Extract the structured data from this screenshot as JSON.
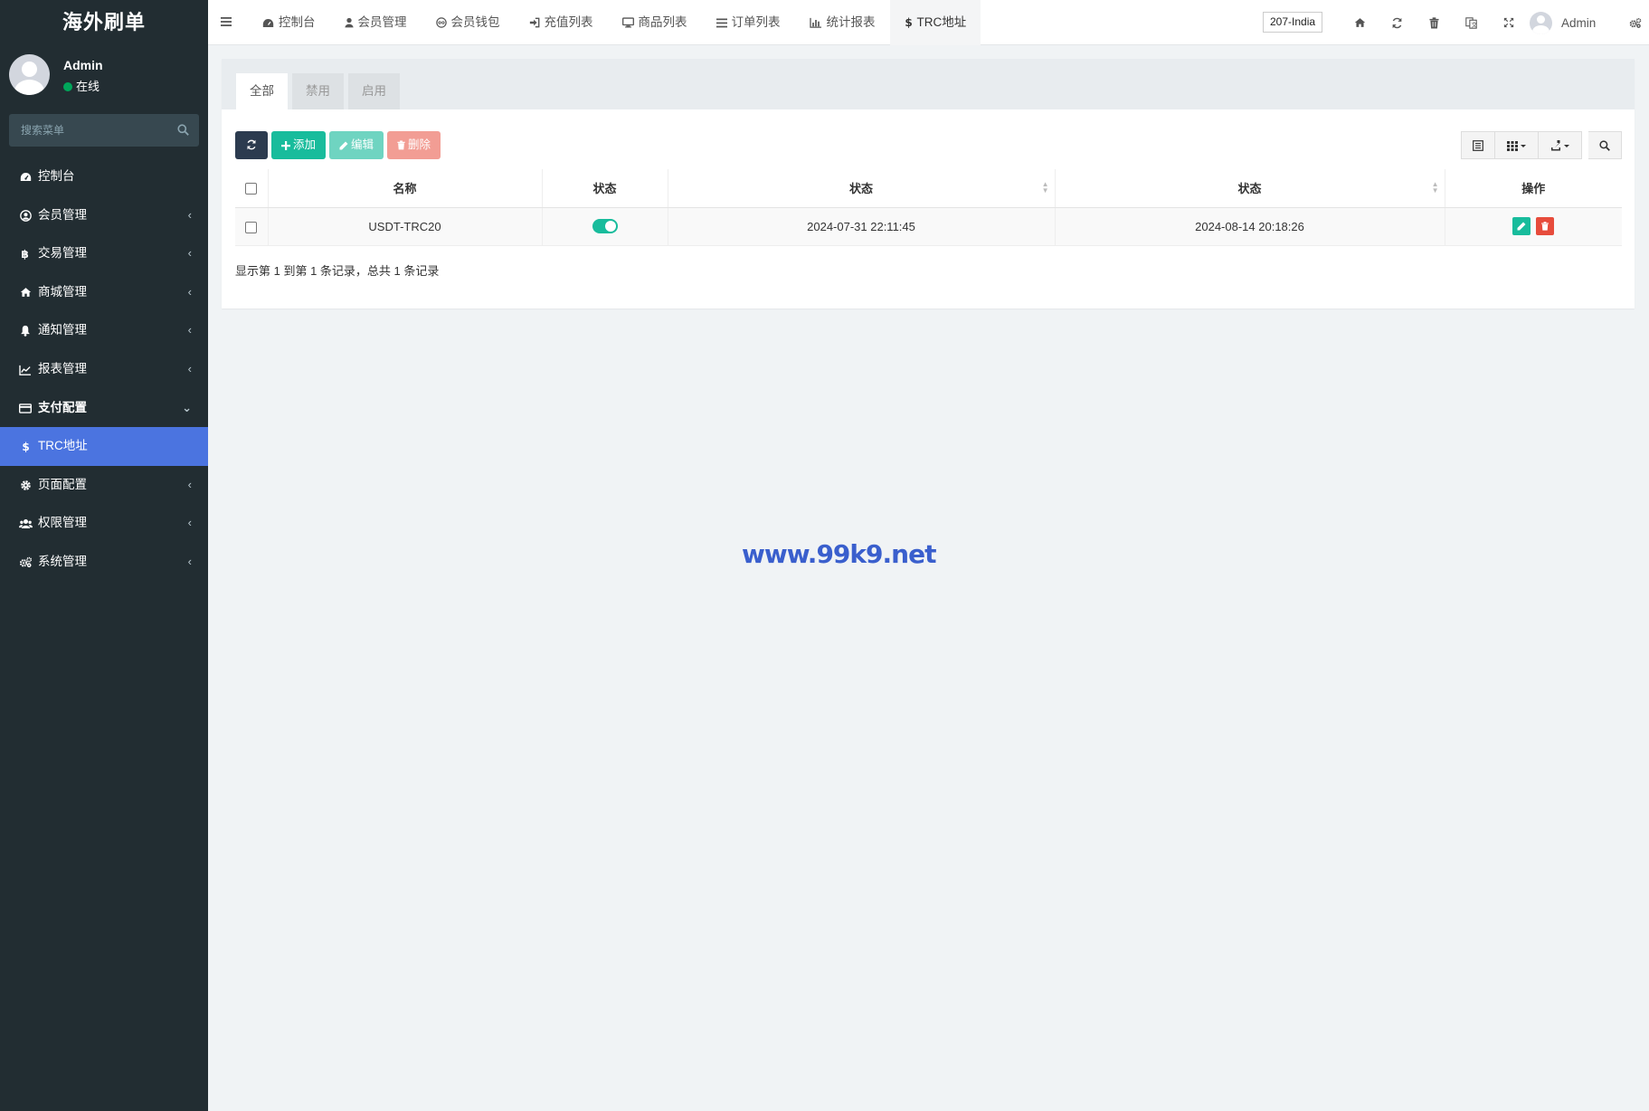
{
  "brand": {
    "title": "海外刷单"
  },
  "user": {
    "name": "Admin",
    "status": "在线"
  },
  "sidebar": {
    "search_placeholder": "搜索菜单",
    "items": [
      {
        "label": "控制台",
        "icon": "dashboard-icon"
      },
      {
        "label": "会员管理",
        "icon": "user-circle-icon"
      },
      {
        "label": "交易管理",
        "icon": "bitcoin-icon"
      },
      {
        "label": "商城管理",
        "icon": "home-icon"
      },
      {
        "label": "通知管理",
        "icon": "bell-icon"
      },
      {
        "label": "报表管理",
        "icon": "line-chart-icon"
      },
      {
        "label": "支付配置",
        "icon": "credit-card-icon"
      },
      {
        "label": "TRC地址",
        "icon": "dollar-icon"
      },
      {
        "label": "页面配置",
        "icon": "gear-icon"
      },
      {
        "label": "权限管理",
        "icon": "users-icon"
      },
      {
        "label": "系统管理",
        "icon": "gears-icon"
      }
    ]
  },
  "topnav": {
    "tabs": [
      {
        "label": "控制台",
        "icon": "dashboard-icon"
      },
      {
        "label": "会员管理",
        "icon": "user-icon"
      },
      {
        "label": "会员钱包",
        "icon": "wallet-icon"
      },
      {
        "label": "充值列表",
        "icon": "sign-in-icon"
      },
      {
        "label": "商品列表",
        "icon": "desktop-icon"
      },
      {
        "label": "订单列表",
        "icon": "list-icon"
      },
      {
        "label": "统计报表",
        "icon": "bar-chart-icon"
      },
      {
        "label": "TRC地址",
        "icon": "dollar-icon"
      }
    ],
    "server": "207-India",
    "user_name": "Admin"
  },
  "panel": {
    "tabs": [
      "全部",
      "禁用",
      "启用"
    ],
    "buttons": {
      "add": "添加",
      "edit": "编辑",
      "delete": "删除"
    },
    "table": {
      "headers": [
        "名称",
        "状态",
        "状态",
        "状态",
        "操作"
      ],
      "rows": [
        {
          "name": "USDT-TRC20",
          "enabled": true,
          "created": "2024-07-31 22:11:45",
          "updated": "2024-08-14 20:18:26"
        }
      ]
    },
    "pagination": "显示第 1 到第 1 条记录，总共 1 条记录"
  },
  "watermark": "www.99k9.net",
  "colors": {
    "sidebar_bg": "#222d32",
    "active_menu": "#4b74e0",
    "primary_green": "#18bc9c",
    "danger_red": "#e74c3c",
    "dark_button": "#2c3b4f"
  }
}
